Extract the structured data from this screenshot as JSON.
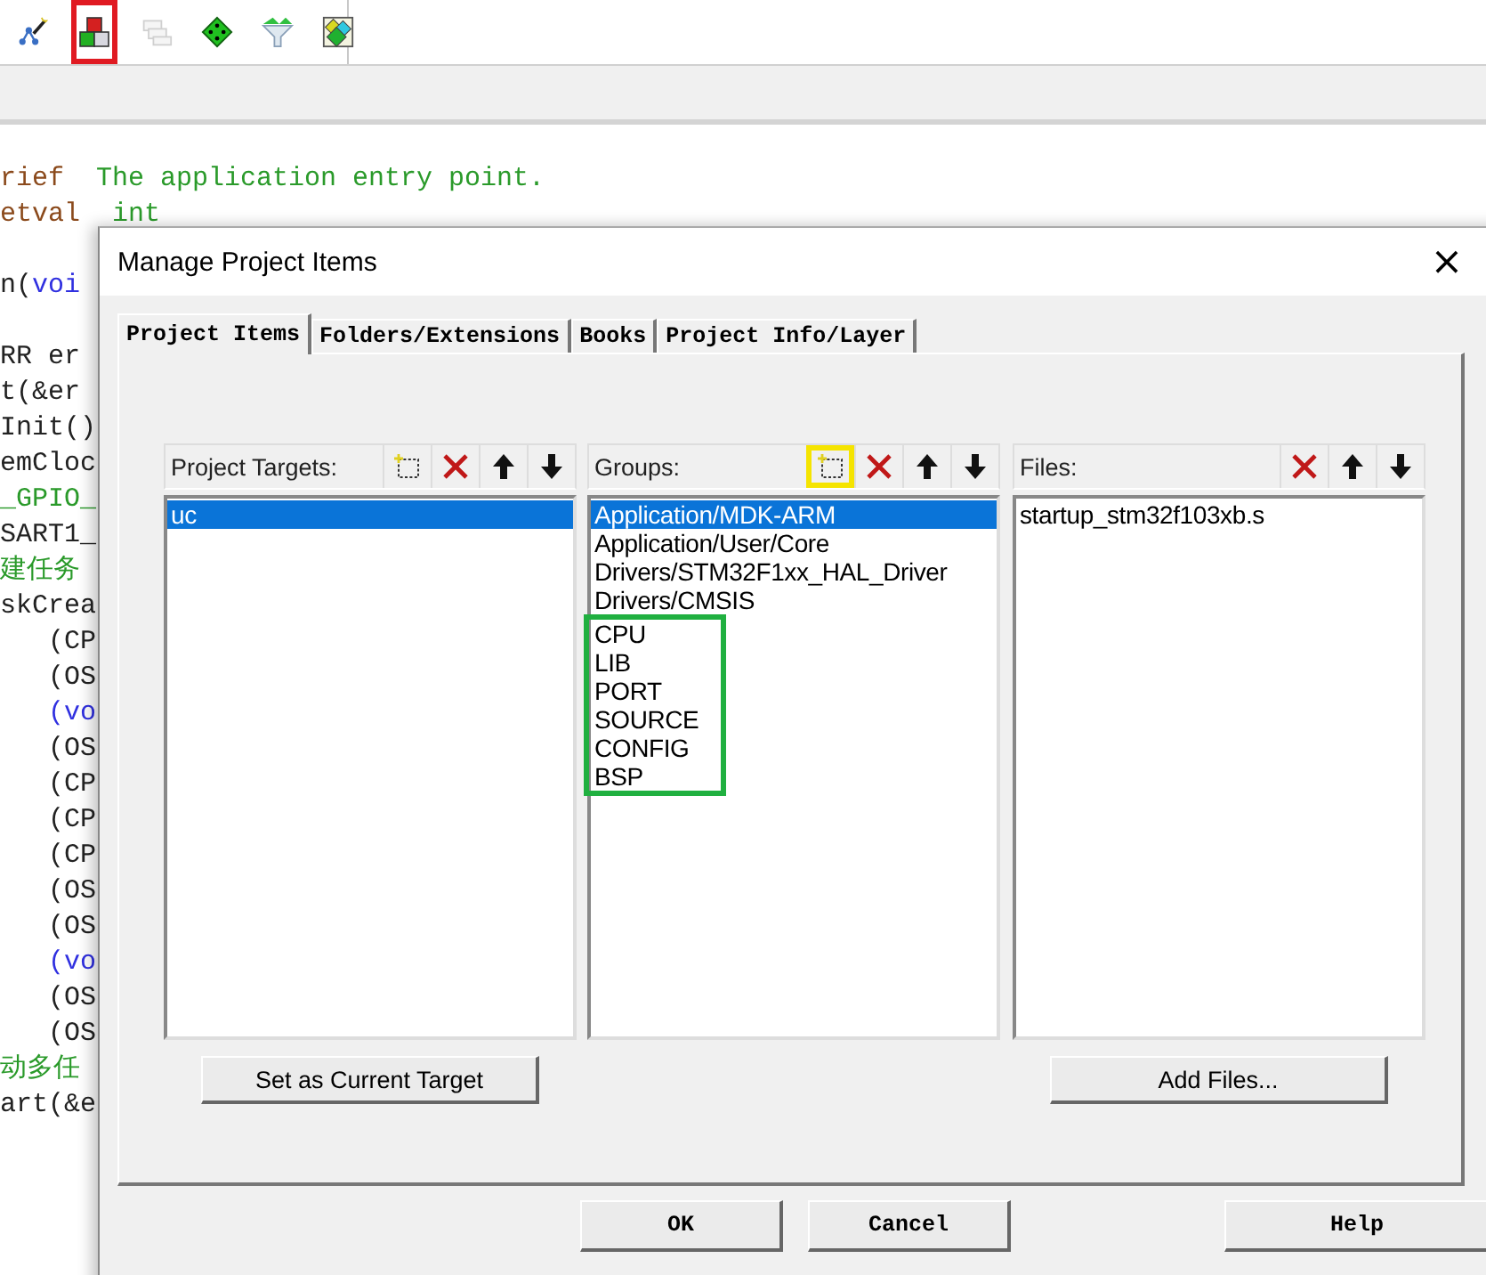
{
  "toolbar": {
    "icons": [
      {
        "kind": "wizard",
        "highlighted": false,
        "disabled": false
      },
      {
        "kind": "blocks",
        "highlighted": true,
        "disabled": false
      },
      {
        "kind": "stack",
        "highlighted": false,
        "disabled": true
      },
      {
        "kind": "diamond",
        "highlighted": false,
        "disabled": false
      },
      {
        "kind": "funnel",
        "highlighted": false,
        "disabled": false
      },
      {
        "kind": "multi",
        "highlighted": false,
        "disabled": false
      }
    ]
  },
  "editor": {
    "lines": [
      {
        "kind": "code",
        "segments": [
          {
            "text": "rief",
            "kind": "tag"
          },
          {
            "text": "The application entry point.",
            "kind": "comment"
          }
        ]
      },
      {
        "kind": "code",
        "segments": [
          {
            "text": "etval",
            "kind": "tag"
          },
          {
            "text": "int",
            "kind": "comment"
          }
        ]
      },
      {
        "kind": "blank"
      },
      {
        "kind": "code",
        "segments": [
          {
            "text": "n(",
            "kind": "plain"
          },
          {
            "text": "voi",
            "kind": "keyword"
          }
        ]
      },
      {
        "kind": "blank"
      },
      {
        "kind": "code",
        "segments": [
          {
            "text": "RR  er",
            "kind": "plain"
          }
        ]
      },
      {
        "kind": "code",
        "segments": [
          {
            "text": "t(&er",
            "kind": "plain"
          }
        ]
      },
      {
        "kind": "code",
        "segments": [
          {
            "text": "Init()",
            "kind": "plain"
          }
        ]
      },
      {
        "kind": "code",
        "segments": [
          {
            "text": "emCloc",
            "kind": "plain"
          }
        ]
      },
      {
        "kind": "code",
        "segments": [
          {
            "text": "_GPIO_",
            "kind": "comment"
          }
        ]
      },
      {
        "kind": "code",
        "segments": [
          {
            "text": "SART1_",
            "kind": "plain"
          }
        ]
      },
      {
        "kind": "code",
        "segments": [
          {
            "text": "建任务",
            "kind": "comment"
          }
        ]
      },
      {
        "kind": "code",
        "segments": [
          {
            "text": "skCrea",
            "kind": "plain"
          }
        ]
      },
      {
        "kind": "indented",
        "segments": [
          {
            "text": "(CP",
            "kind": "plain"
          }
        ]
      },
      {
        "kind": "indented",
        "segments": [
          {
            "text": "(OS",
            "kind": "plain"
          }
        ]
      },
      {
        "kind": "indented",
        "segments": [
          {
            "text": "(vo",
            "kind": "keyword"
          }
        ]
      },
      {
        "kind": "indented",
        "segments": [
          {
            "text": "(OS",
            "kind": "plain"
          }
        ]
      },
      {
        "kind": "indented",
        "segments": [
          {
            "text": "(CP",
            "kind": "plain"
          }
        ]
      },
      {
        "kind": "indented",
        "segments": [
          {
            "text": "(CP",
            "kind": "plain"
          }
        ]
      },
      {
        "kind": "indented",
        "segments": [
          {
            "text": "(CP",
            "kind": "plain"
          }
        ]
      },
      {
        "kind": "indented",
        "segments": [
          {
            "text": "(OS",
            "kind": "plain"
          }
        ]
      },
      {
        "kind": "indented",
        "segments": [
          {
            "text": "(OS",
            "kind": "plain"
          }
        ]
      },
      {
        "kind": "indented",
        "segments": [
          {
            "text": "(vo",
            "kind": "keyword"
          }
        ]
      },
      {
        "kind": "indented",
        "segments": [
          {
            "text": "(OS",
            "kind": "plain"
          }
        ]
      },
      {
        "kind": "indented",
        "segments": [
          {
            "text": "(OS",
            "kind": "plain"
          }
        ]
      },
      {
        "kind": "code",
        "segments": [
          {
            "text": "动多任",
            "kind": "comment"
          }
        ]
      },
      {
        "kind": "code",
        "segments": [
          {
            "text": "art(&e",
            "kind": "plain"
          }
        ]
      }
    ]
  },
  "dialog": {
    "title": "Manage Project Items",
    "close": "×",
    "tabs": [
      {
        "label": "Project Items",
        "selected": true
      },
      {
        "label": "Folders/Extensions",
        "selected": false
      },
      {
        "label": "Books",
        "selected": false
      },
      {
        "label": "Project Info/Layer",
        "selected": false
      }
    ],
    "panels": [
      {
        "title": "Project Targets:",
        "buttons": [
          {
            "kind": "new",
            "highlighted": false
          },
          {
            "kind": "delete",
            "highlighted": false
          },
          {
            "kind": "up",
            "highlighted": false
          },
          {
            "kind": "down",
            "highlighted": false
          }
        ],
        "items": [
          {
            "text": "uc",
            "selected": true
          }
        ],
        "action": "Set as Current Target"
      },
      {
        "title": "Groups:",
        "buttons": [
          {
            "kind": "new",
            "highlighted": true
          },
          {
            "kind": "delete",
            "highlighted": false
          },
          {
            "kind": "up",
            "highlighted": false
          },
          {
            "kind": "down",
            "highlighted": false
          }
        ],
        "items": [
          {
            "text": "Application/MDK-ARM",
            "selected": true,
            "boxed": false
          },
          {
            "text": "Application/User/Core",
            "selected": false,
            "boxed": false
          },
          {
            "text": "Drivers/STM32F1xx_HAL_Driver",
            "selected": false,
            "boxed": false
          },
          {
            "text": "Drivers/CMSIS",
            "selected": false,
            "boxed": false
          },
          {
            "text": "CPU",
            "selected": false,
            "boxed": true
          },
          {
            "text": "LIB",
            "selected": false,
            "boxed": true
          },
          {
            "text": "PORT",
            "selected": false,
            "boxed": true
          },
          {
            "text": "SOURCE",
            "selected": false,
            "boxed": true
          },
          {
            "text": "CONFIG",
            "selected": false,
            "boxed": true
          },
          {
            "text": "BSP",
            "selected": false,
            "boxed": true
          }
        ]
      },
      {
        "title": "Files:",
        "buttons": [
          {
            "kind": "delete",
            "highlighted": false
          },
          {
            "kind": "up",
            "highlighted": false
          },
          {
            "kind": "down",
            "highlighted": false
          }
        ],
        "items": [
          {
            "text": "startup_stm32f103xb.s",
            "selected": false
          }
        ],
        "action": "Add Files..."
      }
    ],
    "footer_buttons": [
      "OK",
      "Cancel",
      "Help"
    ]
  }
}
